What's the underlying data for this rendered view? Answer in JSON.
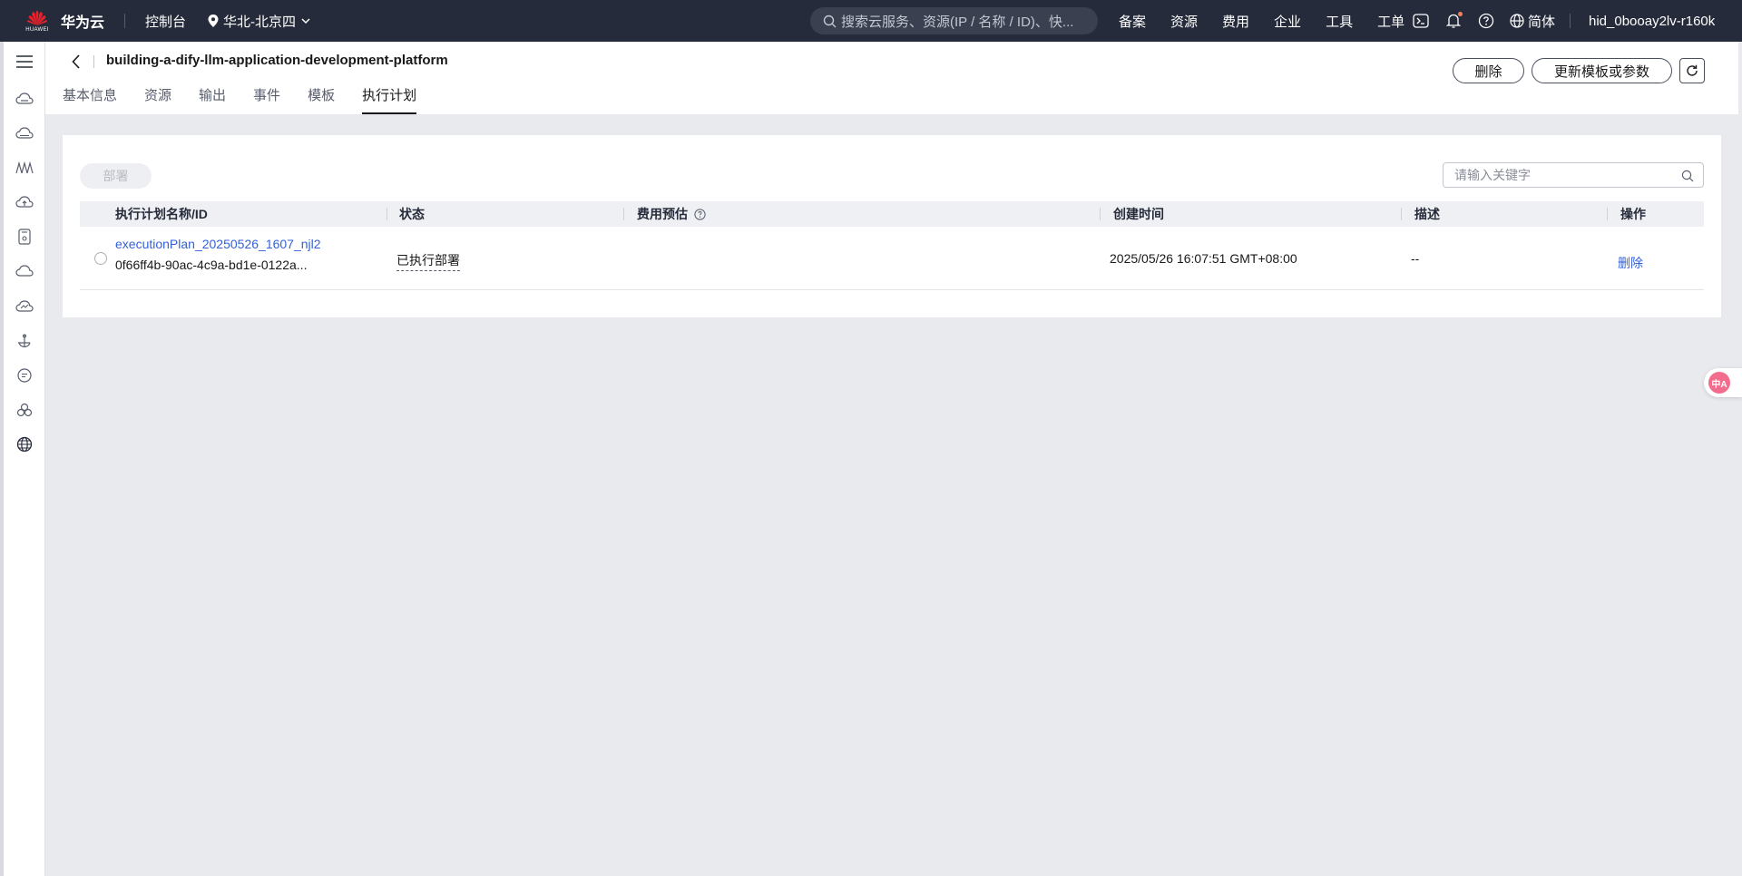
{
  "topbar": {
    "brand_small": "HUAWEI",
    "brand": "华为云",
    "console": "控制台",
    "region": "华北-北京四",
    "search_placeholder": "搜索云服务、资源(IP / 名称 / ID)、快...",
    "nav": [
      "备案",
      "资源",
      "费用",
      "企业",
      "工具",
      "工单"
    ],
    "lang": "简体",
    "user": "hid_0booay2lv-r160k"
  },
  "sidebar": {
    "icons": [
      "menu-icon",
      "cloud-server-icon",
      "cloud-storage-icon",
      "model-arts-icon",
      "cloud-upload-icon",
      "storage-device-icon",
      "cloud-icon",
      "cloud-network-icon",
      "anchor-icon",
      "message-icon",
      "cluster-icon",
      "globe-icon"
    ]
  },
  "header": {
    "title": "building-a-dify-llm-application-development-platform",
    "tabs": [
      "基本信息",
      "资源",
      "输出",
      "事件",
      "模板",
      "执行计划"
    ],
    "active_tab": "执行计划",
    "delete_label": "删除",
    "update_label": "更新模板或参数"
  },
  "main": {
    "deploy_label": "部署",
    "search_placeholder": "请输入关键字",
    "columns": [
      "执行计划名称/ID",
      "状态",
      "费用预估",
      "创建时间",
      "描述",
      "操作"
    ],
    "rows": [
      {
        "name": "executionPlan_20250526_1607_njl2",
        "id": "0f66ff4b-90ac-4c9a-bd1e-0122a...",
        "status": "已执行部署",
        "cost": "",
        "created": "2025/05/26 16:07:51 GMT+08:00",
        "description": "--",
        "action": "删除"
      }
    ]
  },
  "float": {
    "label": "中A"
  },
  "colors": {
    "topbar": "#252b3a",
    "link": "#3361d8",
    "page_bg": "#e9eaee"
  }
}
